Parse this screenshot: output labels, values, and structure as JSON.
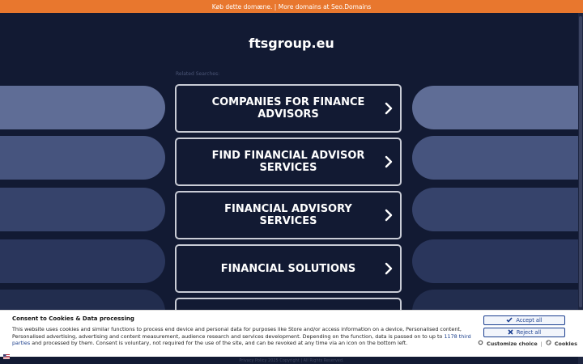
{
  "banner": {
    "text": "Køb dette domæne. | More domains at Seo.Domains"
  },
  "domain": "ftsgroup.eu",
  "related_label": "Related Searches:",
  "search_items": [
    {
      "label": "COMPANIES FOR FINANCE ADVISORS"
    },
    {
      "label": "FIND FINANCIAL ADVISOR SERVICES"
    },
    {
      "label": "FINANCIAL ADVISORY SERVICES"
    },
    {
      "label": "FINANCIAL SOLUTIONS"
    },
    {
      "label": ""
    }
  ],
  "footer": {
    "text": "Privacy Policy   2025 Copyright | All Rights Reserved."
  },
  "consent": {
    "title": "Consent to Cookies & Data processing",
    "text_before": "This website uses cookies and similar functions to process end device and personal data for purposes like Store and/or access information on a device, Personalised content, Personalised advertising, advertising and content measurement, audience research and services development. Depending on the function, data is passed on to up to ",
    "third_parties_link": "1178 third parties",
    "text_after": " and processed by them. Consent is voluntary, not required for the use of the site, and can be revoked at any time via an icon on the bottom left.",
    "accept_label": "Accept all",
    "reject_label": "Reject all",
    "customize_label": "Customize choice",
    "cookies_label": "Cookies",
    "separator": "|"
  },
  "colors": {
    "banner": "#e8772e",
    "background": "#121a33",
    "consent_accent": "#1b3f90"
  }
}
